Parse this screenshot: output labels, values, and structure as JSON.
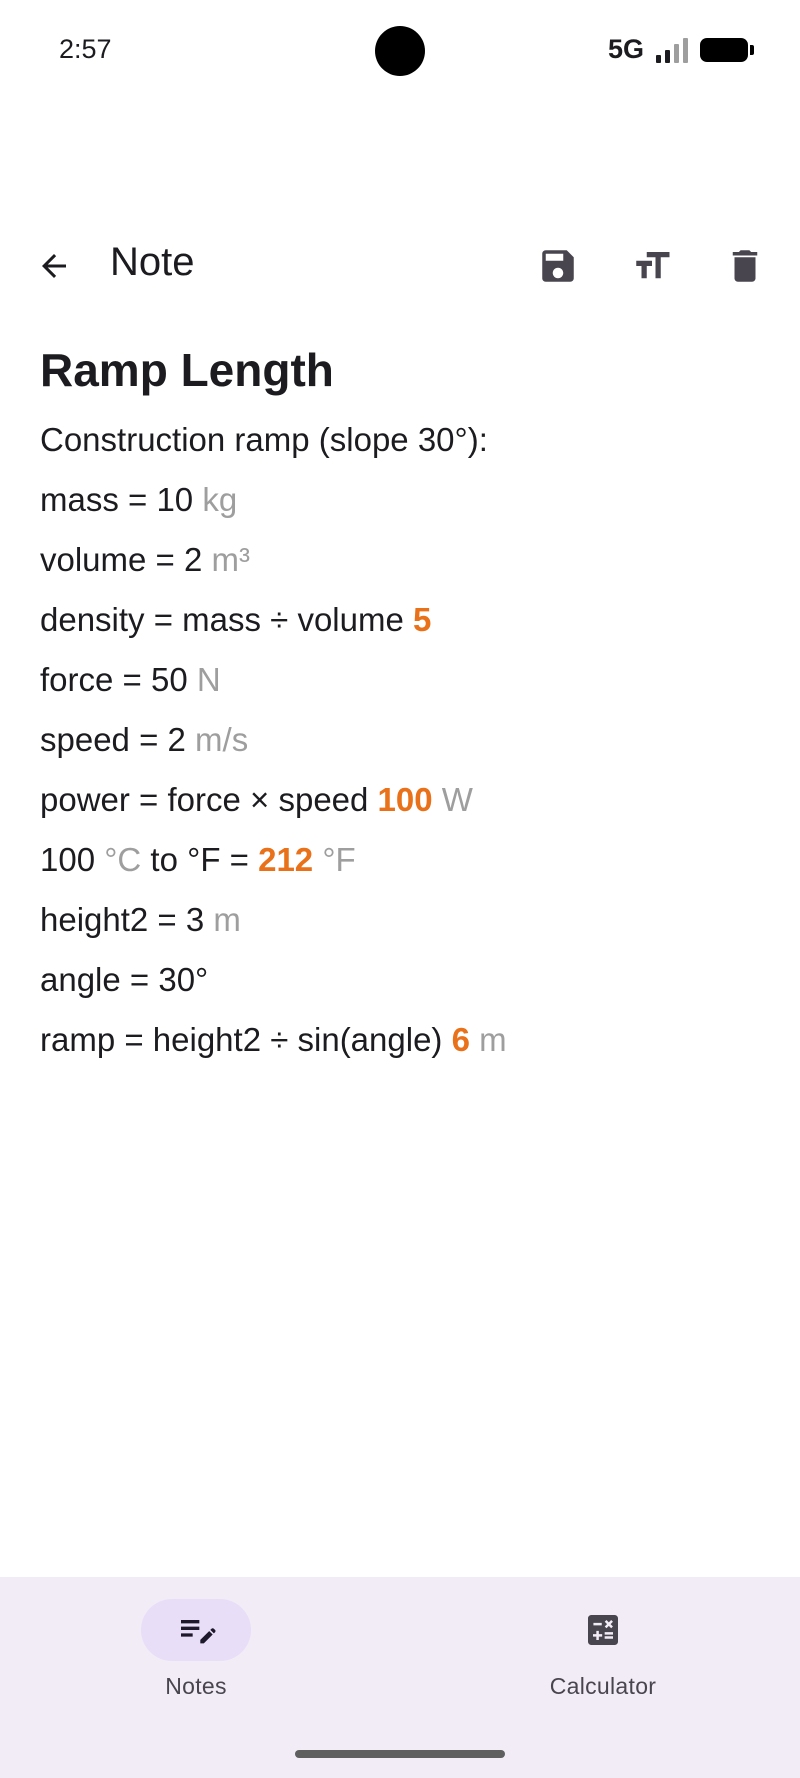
{
  "status_bar": {
    "time": "2:57",
    "network": "5G"
  },
  "app_bar": {
    "title": "Note",
    "icons": [
      "arrow-back-icon",
      "save-icon",
      "text-size-icon",
      "delete-icon"
    ]
  },
  "note": {
    "title": "Ramp Length",
    "lines": [
      [
        {
          "t": "Construction ramp (slope 30°):",
          "k": "text"
        }
      ],
      [
        {
          "t": "mass = 10 ",
          "k": "text"
        },
        {
          "t": "kg",
          "k": "unit"
        }
      ],
      [
        {
          "t": "volume = 2 ",
          "k": "text"
        },
        {
          "t": "m³",
          "k": "unit"
        }
      ],
      [
        {
          "t": "density = mass ÷ volume ",
          "k": "text"
        },
        {
          "t": "5",
          "k": "result"
        }
      ],
      [
        {
          "t": "force = 50 ",
          "k": "text"
        },
        {
          "t": "N",
          "k": "unit"
        }
      ],
      [
        {
          "t": "speed = 2 ",
          "k": "text"
        },
        {
          "t": "m/s",
          "k": "unit"
        }
      ],
      [
        {
          "t": "power = force × speed ",
          "k": "text"
        },
        {
          "t": "100",
          "k": "result"
        },
        {
          "t": " ",
          "k": "text"
        },
        {
          "t": "W",
          "k": "unit"
        }
      ],
      [
        {
          "t": "100 ",
          "k": "text"
        },
        {
          "t": "°C",
          "k": "unit"
        },
        {
          "t": " to °F = ",
          "k": "text"
        },
        {
          "t": "212",
          "k": "result"
        },
        {
          "t": " ",
          "k": "text"
        },
        {
          "t": "°F",
          "k": "unit"
        }
      ],
      [
        {
          "t": "height2 = 3 ",
          "k": "text"
        },
        {
          "t": "m",
          "k": "unit"
        }
      ],
      [
        {
          "t": "angle = 30°",
          "k": "text"
        }
      ],
      [
        {
          "t": "ramp = height2 ÷ sin(angle) ",
          "k": "text"
        },
        {
          "t": "6",
          "k": "result"
        },
        {
          "t": " ",
          "k": "text"
        },
        {
          "t": "m",
          "k": "unit"
        }
      ]
    ]
  },
  "bottom_nav": {
    "items": [
      {
        "label": "Notes",
        "icon": "notes-edit-icon",
        "active": true
      },
      {
        "label": "Calculator",
        "icon": "calculator-icon",
        "active": false
      }
    ]
  },
  "colors": {
    "result": "#e8711a",
    "unit": "#9e9e9e",
    "nav_background": "#f2ecf6",
    "active_pill": "#e8def8"
  }
}
